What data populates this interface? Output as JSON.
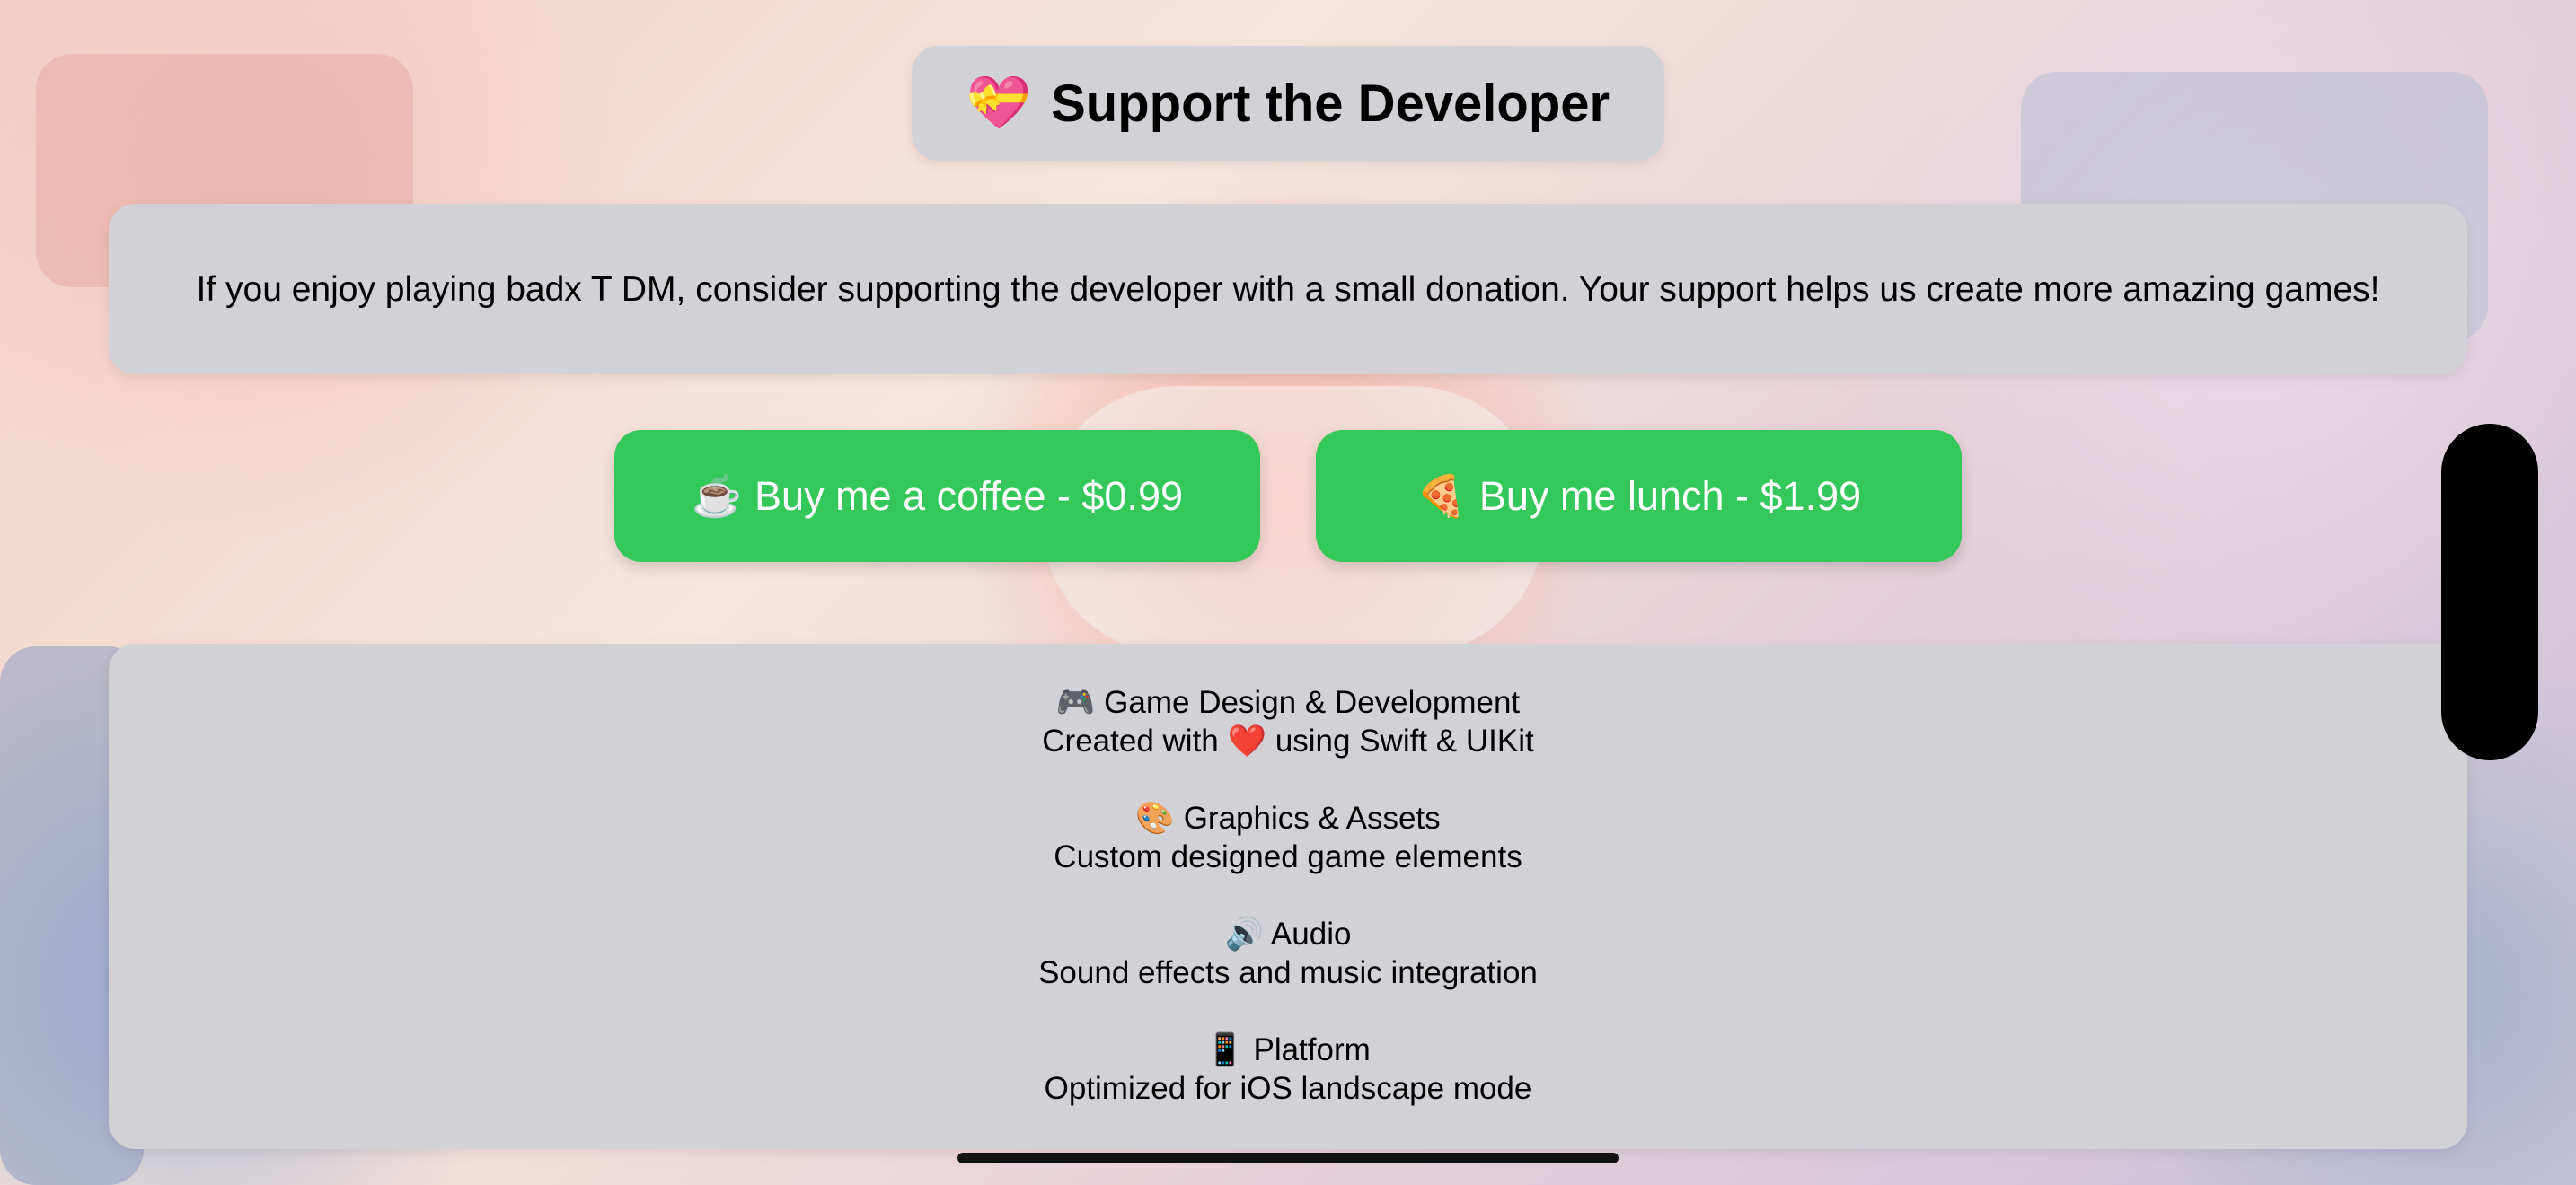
{
  "header": {
    "icon": "💝",
    "title": "Support the Developer"
  },
  "description": "If you enjoy playing badx T DM, consider supporting the developer with a small donation. Your support helps us create more amazing games!",
  "buttons": [
    {
      "icon": "☕️",
      "label": "Buy me a coffee - $0.99"
    },
    {
      "icon": "🍕",
      "label": "Buy me lunch - $1.99"
    }
  ],
  "credits": [
    {
      "icon": "🎮",
      "title": "Game Design & Development",
      "pre": "Created with ",
      "heart": "❤️",
      "post": " using Swift & UIKit"
    },
    {
      "icon": "🎨",
      "title": "Graphics & Assets",
      "subtitle": "Custom designed game elements"
    },
    {
      "icon": "🔊",
      "title": "Audio",
      "subtitle": "Sound effects and music integration"
    },
    {
      "icon": "📱",
      "title": "Platform",
      "subtitle": "Optimized for iOS landscape mode"
    }
  ],
  "colors": {
    "button": "#34c759",
    "panel": "#d2d1d6"
  }
}
